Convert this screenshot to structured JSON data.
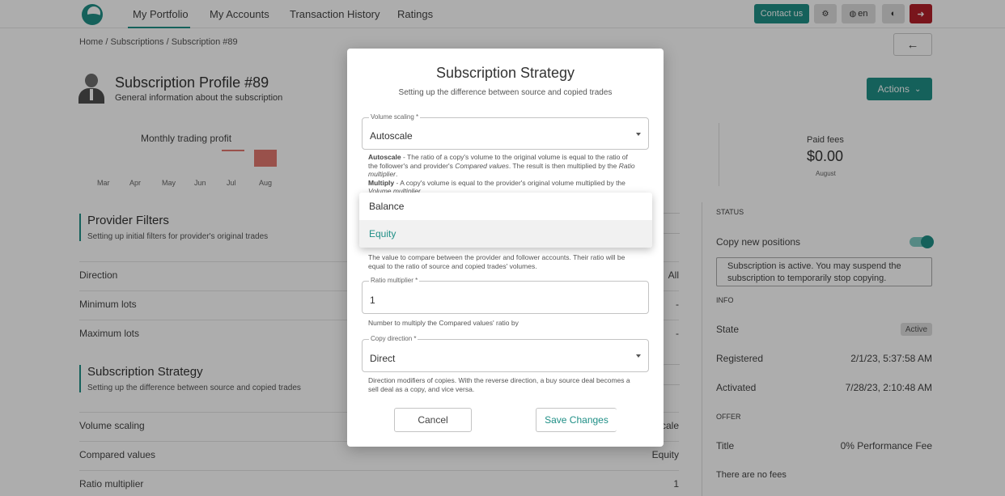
{
  "nav": {
    "links": [
      "My Portfolio",
      "My Accounts",
      "Transaction History",
      "Ratings"
    ],
    "contact": "Contact us",
    "lang": "en"
  },
  "breadcrumb": "Home / Subscriptions / Subscription #89",
  "profile": {
    "title": "Subscription Profile #89",
    "subtitle": "General information about the subscription",
    "actions": "Actions"
  },
  "chart_data": {
    "type": "bar",
    "title": "Monthly trading profit",
    "categories": [
      "Mar",
      "Apr",
      "May",
      "Jun",
      "Jul",
      "Aug"
    ],
    "values": [
      0,
      0,
      0,
      0,
      0.1,
      1
    ]
  },
  "fees": {
    "label": "Paid fees",
    "value": "$0.00",
    "month": "August"
  },
  "provider_filters": {
    "title": "Provider Filters",
    "subtitle": "Setting up initial filters for provider's original trades",
    "rows": [
      {
        "label": "Direction",
        "value": "All"
      },
      {
        "label": "Minimum lots",
        "value": "-"
      },
      {
        "label": "Maximum lots",
        "value": "-"
      }
    ]
  },
  "strategy": {
    "title": "Subscription Strategy",
    "subtitle": "Setting up the difference between source and copied trades",
    "rows": [
      {
        "label": "Volume scaling",
        "value": "cale"
      },
      {
        "label": "Compared values",
        "value": "Equity"
      },
      {
        "label": "Ratio multiplier",
        "value": "1"
      }
    ]
  },
  "right": {
    "status_head": "STATUS",
    "copy_label": "Copy new positions",
    "notice": "Subscription is active. You may suspend the subscription to temporarily stop copying.",
    "info_head": "INFO",
    "state_label": "State",
    "state_badge": "Active",
    "registered_label": "Registered",
    "registered_value": "2/1/23, 5:37:58 AM",
    "activated_label": "Activated",
    "activated_value": "7/28/23, 2:10:48 AM",
    "offer_head": "OFFER",
    "title_label": "Title",
    "title_value": "0% Performance Fee",
    "no_fees": "There are no fees"
  },
  "modal": {
    "title": "Subscription Strategy",
    "subtitle": "Setting up the difference between source and copied trades",
    "volume_label": "Volume scaling *",
    "volume_value": "Autoscale",
    "help1_autoscale_b": "Autoscale",
    "help1_autoscale_t1": " - The ratio of a copy's volume to the original volume is equal to the ratio of the follower's and provider's ",
    "help1_autoscale_i1": "Compared values",
    "help1_autoscale_t2": ". The result is then multiplied by the ",
    "help1_autoscale_i2": "Ratio multiplier",
    "help1_autoscale_t3": ".",
    "help1_multiply_b": "Multiply",
    "help1_multiply_t1": " - A copy's volume is equal to the provider's original volume multiplied by the ",
    "help1_multiply_i1": "Volume multiplier",
    "help1_multiply_t2": ".",
    "options": [
      "Balance",
      "Equity"
    ],
    "compared_help": "The value to compare between the provider and follower accounts. Their ratio will be equal to the ratio of source and copied trades' volumes.",
    "ratio_label": "Ratio multiplier *",
    "ratio_value": "1",
    "ratio_help": "Number to multiply the Compared values' ratio by",
    "direction_label": "Copy direction *",
    "direction_value": "Direct",
    "direction_help": "Direction modifiers of copies. With the reverse direction, a buy source deal becomes a sell deal as a copy, and vice versa.",
    "cancel": "Cancel",
    "save": "Save Changes"
  }
}
